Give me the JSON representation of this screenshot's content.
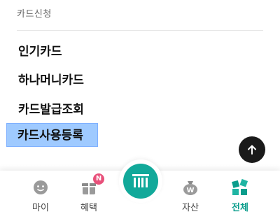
{
  "section": {
    "title": "카드신청"
  },
  "menu": {
    "items": [
      {
        "label": "인기카드"
      },
      {
        "label": "하나머니카드"
      },
      {
        "label": "카드발급조회"
      },
      {
        "label": "카드사용등록"
      }
    ]
  },
  "tabbar": {
    "tabs": [
      {
        "label": "마이",
        "icon": "face-icon"
      },
      {
        "label": "혜택",
        "icon": "gift-icon",
        "badge": "N"
      },
      {
        "label": "",
        "icon": "center-menu-icon"
      },
      {
        "label": "자산",
        "icon": "money-bag-icon"
      },
      {
        "label": "전체",
        "icon": "all-menu-icon",
        "active": true
      }
    ]
  },
  "colors": {
    "accent": "#12a99a",
    "selected_highlight": "#9fcaff",
    "badge": "#e8507a"
  }
}
